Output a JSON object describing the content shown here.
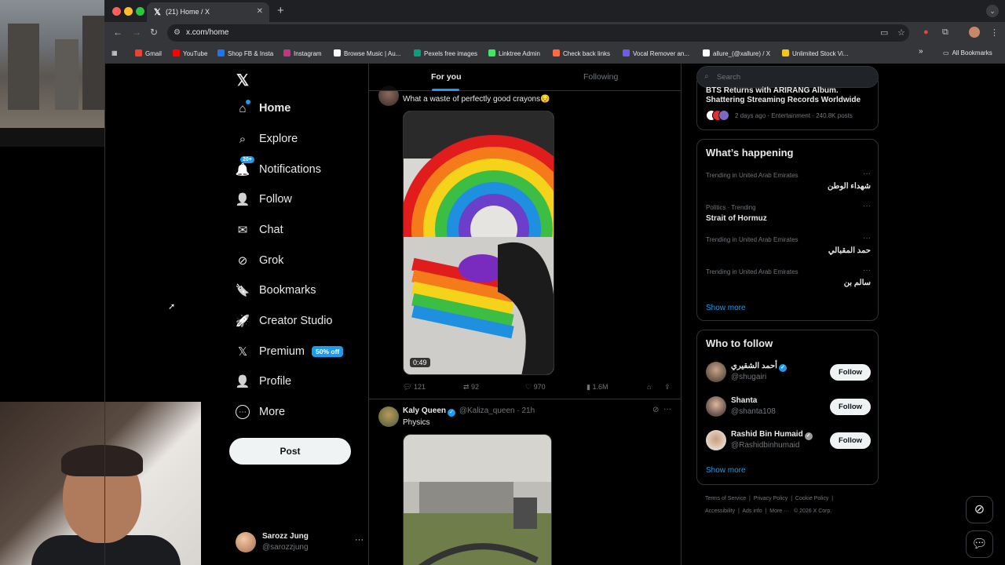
{
  "browser": {
    "tab_title": "(21) Home / X",
    "tab_logo": "𝕏",
    "tab_close": "✕",
    "new_tab": "+",
    "tab_dropdown": "⌄",
    "url": "x.com/home",
    "nav_icons": {
      "back": "←",
      "forward": "→",
      "reload": "↻"
    },
    "bookmarks": [
      {
        "label": "Gmail",
        "color": "#ea4335"
      },
      {
        "label": "YouTube",
        "color": "#ff0000"
      },
      {
        "label": "Shop FB & Insta",
        "color": "#1877f2"
      },
      {
        "label": "Instagram",
        "color": "#c13584"
      },
      {
        "label": "Browse Music | Au...",
        "color": "#ffffff"
      },
      {
        "label": "Pexels free images",
        "color": "#05a081"
      },
      {
        "label": "Linktree Admin",
        "color": "#43e660"
      },
      {
        "label": "Check back links",
        "color": "#ff6a3d"
      },
      {
        "label": "Vocal Remover an...",
        "color": "#6c5ce7"
      },
      {
        "label": "allure_(@xallure) / X",
        "color": "#ffffff"
      },
      {
        "label": "Unlimited Stock Vi...",
        "color": "#f5c518"
      }
    ],
    "bookmarks_overflow": "»",
    "all_bookmarks": "All Bookmarks",
    "window_dots": [
      "#ff5f57",
      "#febc2e",
      "#28c840"
    ]
  },
  "nav": {
    "logo": "𝕏",
    "items": [
      {
        "label": "Home",
        "icon": "⌂"
      },
      {
        "label": "Explore",
        "icon": "⌕"
      },
      {
        "label": "Notifications",
        "icon": "🔔",
        "badge": "20+"
      },
      {
        "label": "Follow",
        "icon": "👤"
      },
      {
        "label": "Chat",
        "icon": "✉"
      },
      {
        "label": "Grok",
        "icon": "⊘"
      },
      {
        "label": "Bookmarks",
        "icon": "🔖"
      },
      {
        "label": "Creator Studio",
        "icon": "🚀"
      },
      {
        "label": "Premium",
        "icon": "𝕏",
        "pill": "50% off"
      },
      {
        "label": "Profile",
        "icon": "👤"
      },
      {
        "label": "More",
        "icon": "⋯"
      }
    ],
    "post_button": "Post",
    "account": {
      "name": "Sarozz Jung",
      "handle": "@sarozzjung",
      "more": "···"
    }
  },
  "timeline": {
    "tabs": [
      "For you",
      "Following"
    ],
    "tweets": [
      {
        "text": "What a waste of perfectly good crayons😔",
        "duration": "0:49",
        "replies": "121",
        "reposts": "92",
        "likes": "970",
        "views": "1.6M"
      },
      {
        "name": "Kaly Queen",
        "handle": "@Kaliza_queen · 21h",
        "text": "Physics",
        "more": "···"
      }
    ]
  },
  "right": {
    "search_placeholder": "Search",
    "top_story": {
      "title_partial": "BTS Returns with ARIRANG Album,",
      "title": "Shattering Streaming Records Worldwide",
      "meta": "2 days ago · Entertainment · 240.8K posts"
    },
    "happening": {
      "title": "What’s happening",
      "trends": [
        {
          "context": "Trending in United Arab Emirates",
          "topic": "شهداء الوطن",
          "rtl": true
        },
        {
          "context": "Politics · Trending",
          "topic": "Strait of Hormuz",
          "rtl": false
        },
        {
          "context": "Trending in United Arab Emirates",
          "topic": "حمد المقبالي",
          "rtl": true
        },
        {
          "context": "Trending in United Arab Emirates",
          "topic": "سالم بن",
          "rtl": true
        }
      ],
      "show_more": "Show more"
    },
    "who_to_follow": {
      "title": "Who to follow",
      "users": [
        {
          "name": "أحمد الشقيري",
          "handle": "@shugairi",
          "button": "Follow",
          "verified": "blue"
        },
        {
          "name": "Shanta",
          "handle": "@shanta108",
          "button": "Follow",
          "verified": "none"
        },
        {
          "name": "Rashid Bin Humaid",
          "handle": "@Rashidbinhumaid",
          "button": "Follow",
          "verified": "gray"
        }
      ],
      "show_more": "Show more"
    },
    "footer": {
      "line1": [
        "Terms of Service",
        "Privacy Policy",
        "Cookie Policy"
      ],
      "line2": [
        "Accessibility",
        "Ads info",
        "More ···",
        "© 2026 X Corp."
      ]
    }
  },
  "colors": {
    "accent": "#1d9bf0",
    "background": "#000000",
    "muted": "#71767b"
  }
}
